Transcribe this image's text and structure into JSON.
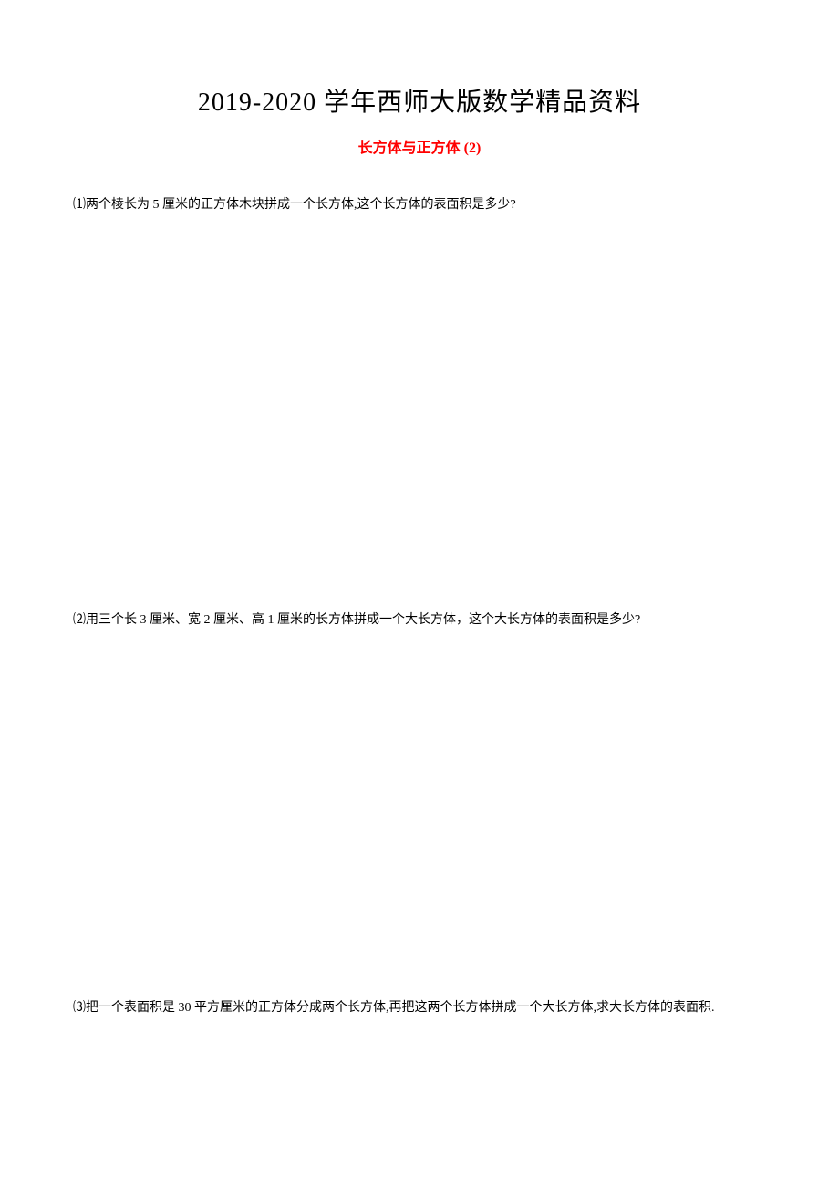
{
  "header": {
    "main_title": "2019-2020 学年西师大版数学精品资料",
    "sub_title": "长方体与正方体 (2)"
  },
  "questions": {
    "q1": "⑴两个棱长为 5 厘米的正方体木块拼成一个长方体,这个长方体的表面积是多少?",
    "q2": "⑵用三个长 3 厘米、宽 2 厘米、高 1 厘米的长方体拼成一个大长方体，这个大长方体的表面积是多少?",
    "q3": "⑶把一个表面积是 30 平方厘米的正方体分成两个长方体,再把这两个长方体拼成一个大长方体,求大长方体的表面积."
  }
}
